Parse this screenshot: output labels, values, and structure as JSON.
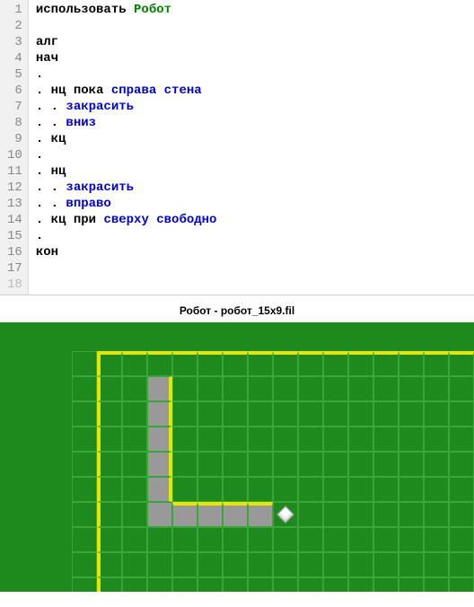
{
  "code": {
    "lines": [
      {
        "n": "1",
        "tokens": [
          {
            "t": "использовать ",
            "c": "kw"
          },
          {
            "t": "Робот",
            "c": "mod"
          }
        ]
      },
      {
        "n": "2",
        "tokens": []
      },
      {
        "n": "3",
        "tokens": [
          {
            "t": "алг",
            "c": "kw"
          }
        ]
      },
      {
        "n": "4",
        "tokens": [
          {
            "t": "нач",
            "c": "kw"
          }
        ]
      },
      {
        "n": "5",
        "tokens": [
          {
            "t": ".",
            "c": "dot"
          }
        ]
      },
      {
        "n": "6",
        "tokens": [
          {
            "t": ". ",
            "c": "dot"
          },
          {
            "t": "нц пока ",
            "c": "kw"
          },
          {
            "t": "справа стена",
            "c": "cmd"
          }
        ]
      },
      {
        "n": "7",
        "tokens": [
          {
            "t": ". . ",
            "c": "dot"
          },
          {
            "t": "закрасить",
            "c": "cmd"
          }
        ]
      },
      {
        "n": "8",
        "tokens": [
          {
            "t": ". . ",
            "c": "dot"
          },
          {
            "t": "вниз",
            "c": "cmd"
          }
        ]
      },
      {
        "n": "9",
        "tokens": [
          {
            "t": ". ",
            "c": "dot"
          },
          {
            "t": "кц",
            "c": "kw"
          }
        ]
      },
      {
        "n": "10",
        "tokens": [
          {
            "t": ".",
            "c": "dot"
          }
        ]
      },
      {
        "n": "11",
        "tokens": [
          {
            "t": ". ",
            "c": "dot"
          },
          {
            "t": "нц",
            "c": "kw"
          }
        ]
      },
      {
        "n": "12",
        "tokens": [
          {
            "t": ". . ",
            "c": "dot"
          },
          {
            "t": "закрасить",
            "c": "cmd"
          }
        ]
      },
      {
        "n": "13",
        "tokens": [
          {
            "t": ". . ",
            "c": "dot"
          },
          {
            "t": "вправо",
            "c": "cmd"
          }
        ]
      },
      {
        "n": "14",
        "tokens": [
          {
            "t": ". ",
            "c": "dot"
          },
          {
            "t": "кц при ",
            "c": "kw"
          },
          {
            "t": "сверху свободно",
            "c": "cmd"
          }
        ]
      },
      {
        "n": "15",
        "tokens": [
          {
            "t": ".",
            "c": "dot"
          }
        ]
      },
      {
        "n": "16",
        "tokens": [
          {
            "t": "кон",
            "c": "kw"
          }
        ]
      },
      {
        "n": "17",
        "tokens": []
      },
      {
        "n": "18",
        "tokens": [],
        "dim": true
      }
    ]
  },
  "field": {
    "title": "Робот - робот_15x9.fil",
    "cell_size": 28,
    "cols": 16,
    "rows": 10,
    "walls": {
      "top_row": 0,
      "top_from_col": 1,
      "left_col": 1,
      "left_from_row": 0,
      "bottom_row": 9,
      "right_col_partial": {
        "col": 3,
        "from_row": 1,
        "to_row": 5
      },
      "top_partial": {
        "row": 6,
        "from_col": 4,
        "to_col": 7
      }
    },
    "painted": [
      {
        "r": 1,
        "c": 3
      },
      {
        "r": 2,
        "c": 3
      },
      {
        "r": 3,
        "c": 3
      },
      {
        "r": 4,
        "c": 3
      },
      {
        "r": 5,
        "c": 3
      },
      {
        "r": 6,
        "c": 3
      },
      {
        "r": 6,
        "c": 4
      },
      {
        "r": 6,
        "c": 5
      },
      {
        "r": 6,
        "c": 6
      },
      {
        "r": 6,
        "c": 7
      }
    ],
    "robot": {
      "r": 6,
      "c": 8
    }
  }
}
